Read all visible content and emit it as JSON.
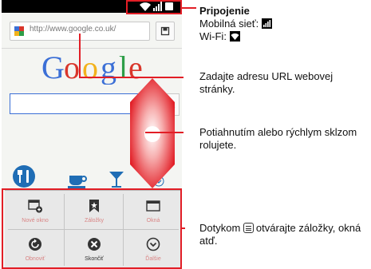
{
  "browser": {
    "url": "http://www.google.co.uk/",
    "logo_text": "Google"
  },
  "menu": {
    "items": [
      {
        "label": "Nové okno",
        "icon": "new-window-icon"
      },
      {
        "label": "Záložky",
        "icon": "bookmark-icon"
      },
      {
        "label": "Okná",
        "icon": "windows-icon"
      },
      {
        "label": "Obnoviť",
        "icon": "refresh-icon"
      },
      {
        "label": "Skončiť",
        "icon": "close-icon"
      },
      {
        "label": "Ďalšie",
        "icon": "more-icon"
      }
    ]
  },
  "callouts": {
    "connection_title": "Pripojenie",
    "mobile_label": "Mobilná sieť:",
    "wifi_label": "Wi-Fi:",
    "url_hint": "Zadajte adresu URL webovej stránky.",
    "scroll_hint": "Potiahnutím alebo rýchlym sklzom rolujete.",
    "menu_hint_a": "Dotykom",
    "menu_hint_b": "otvárajte záložky, okná atď."
  },
  "colors": {
    "accent_red": "#e21e26",
    "google_blue": "#3b6fd6",
    "menu_label": "#d98585"
  }
}
